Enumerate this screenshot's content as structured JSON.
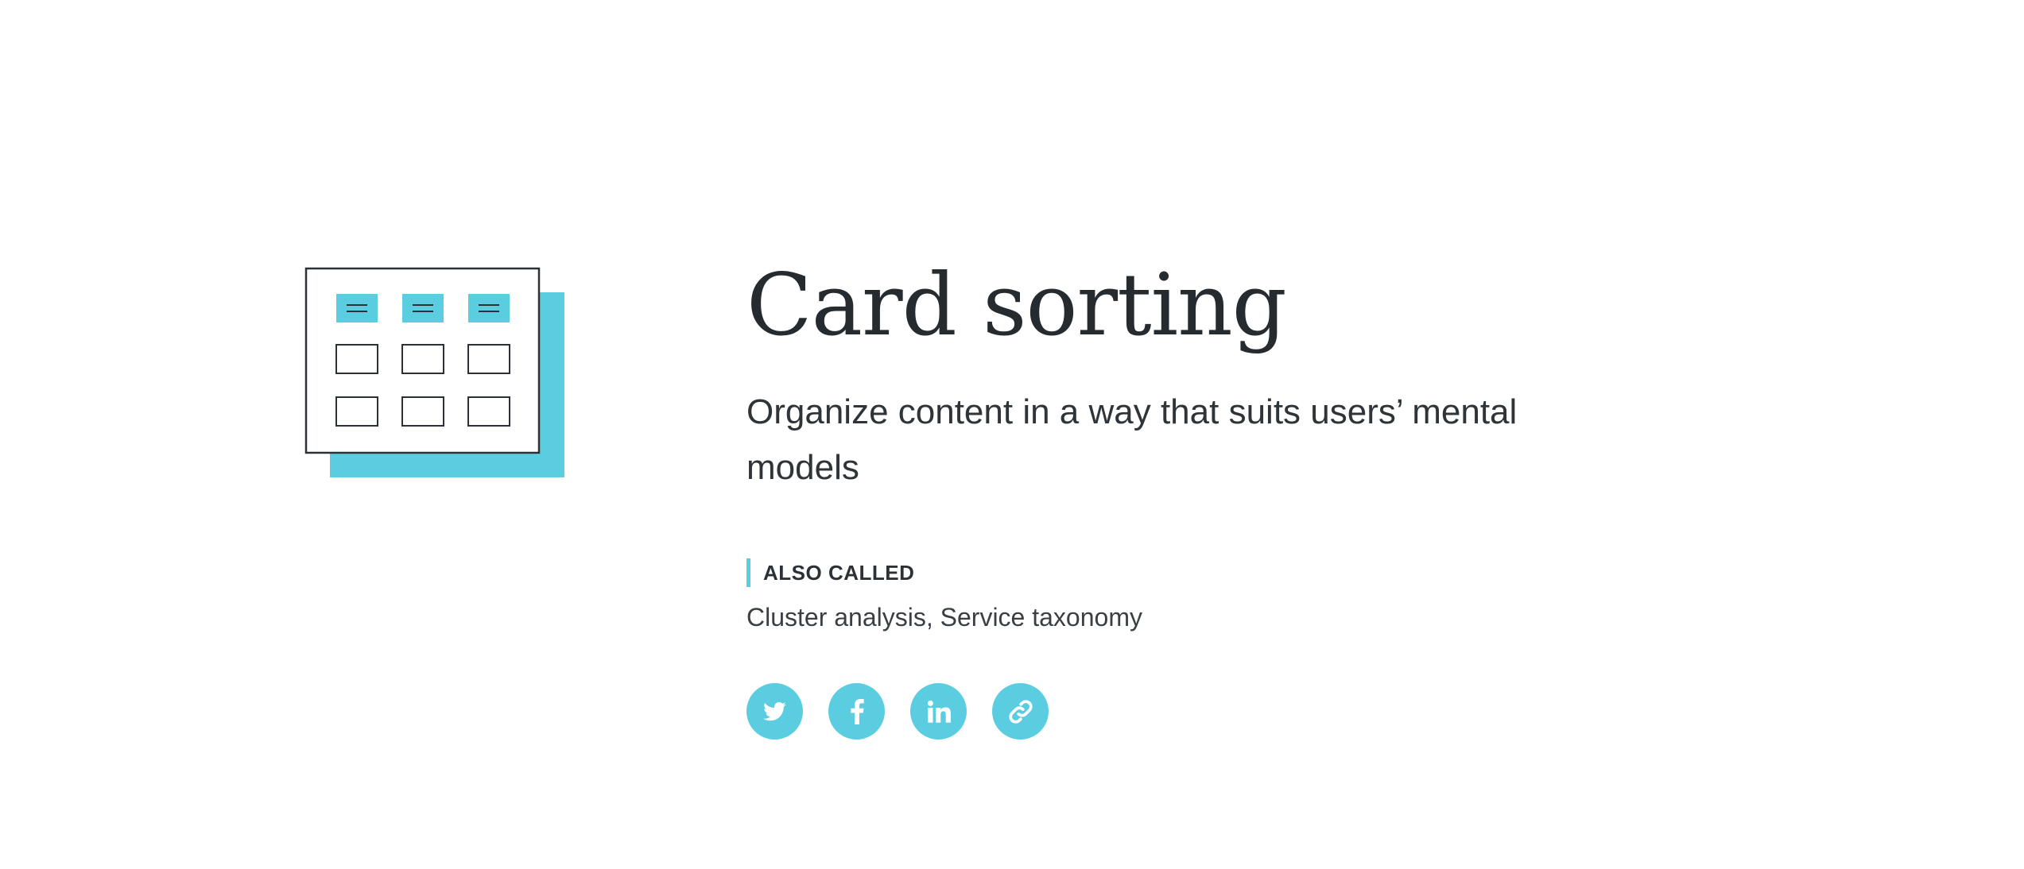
{
  "hero": {
    "title": "Card sorting",
    "subtitle": "Organize content in a way that suits users’ mental models"
  },
  "also_called": {
    "label": "ALSO CALLED",
    "value": "Cluster analysis, Service taxonomy"
  },
  "share": {
    "buttons": [
      {
        "icon": "twitter-icon"
      },
      {
        "icon": "facebook-icon"
      },
      {
        "icon": "linkedin-icon"
      },
      {
        "icon": "link-icon"
      }
    ]
  },
  "colors": {
    "accent": "#5bcde0",
    "text": "#262b30",
    "background": "#ffffff"
  }
}
